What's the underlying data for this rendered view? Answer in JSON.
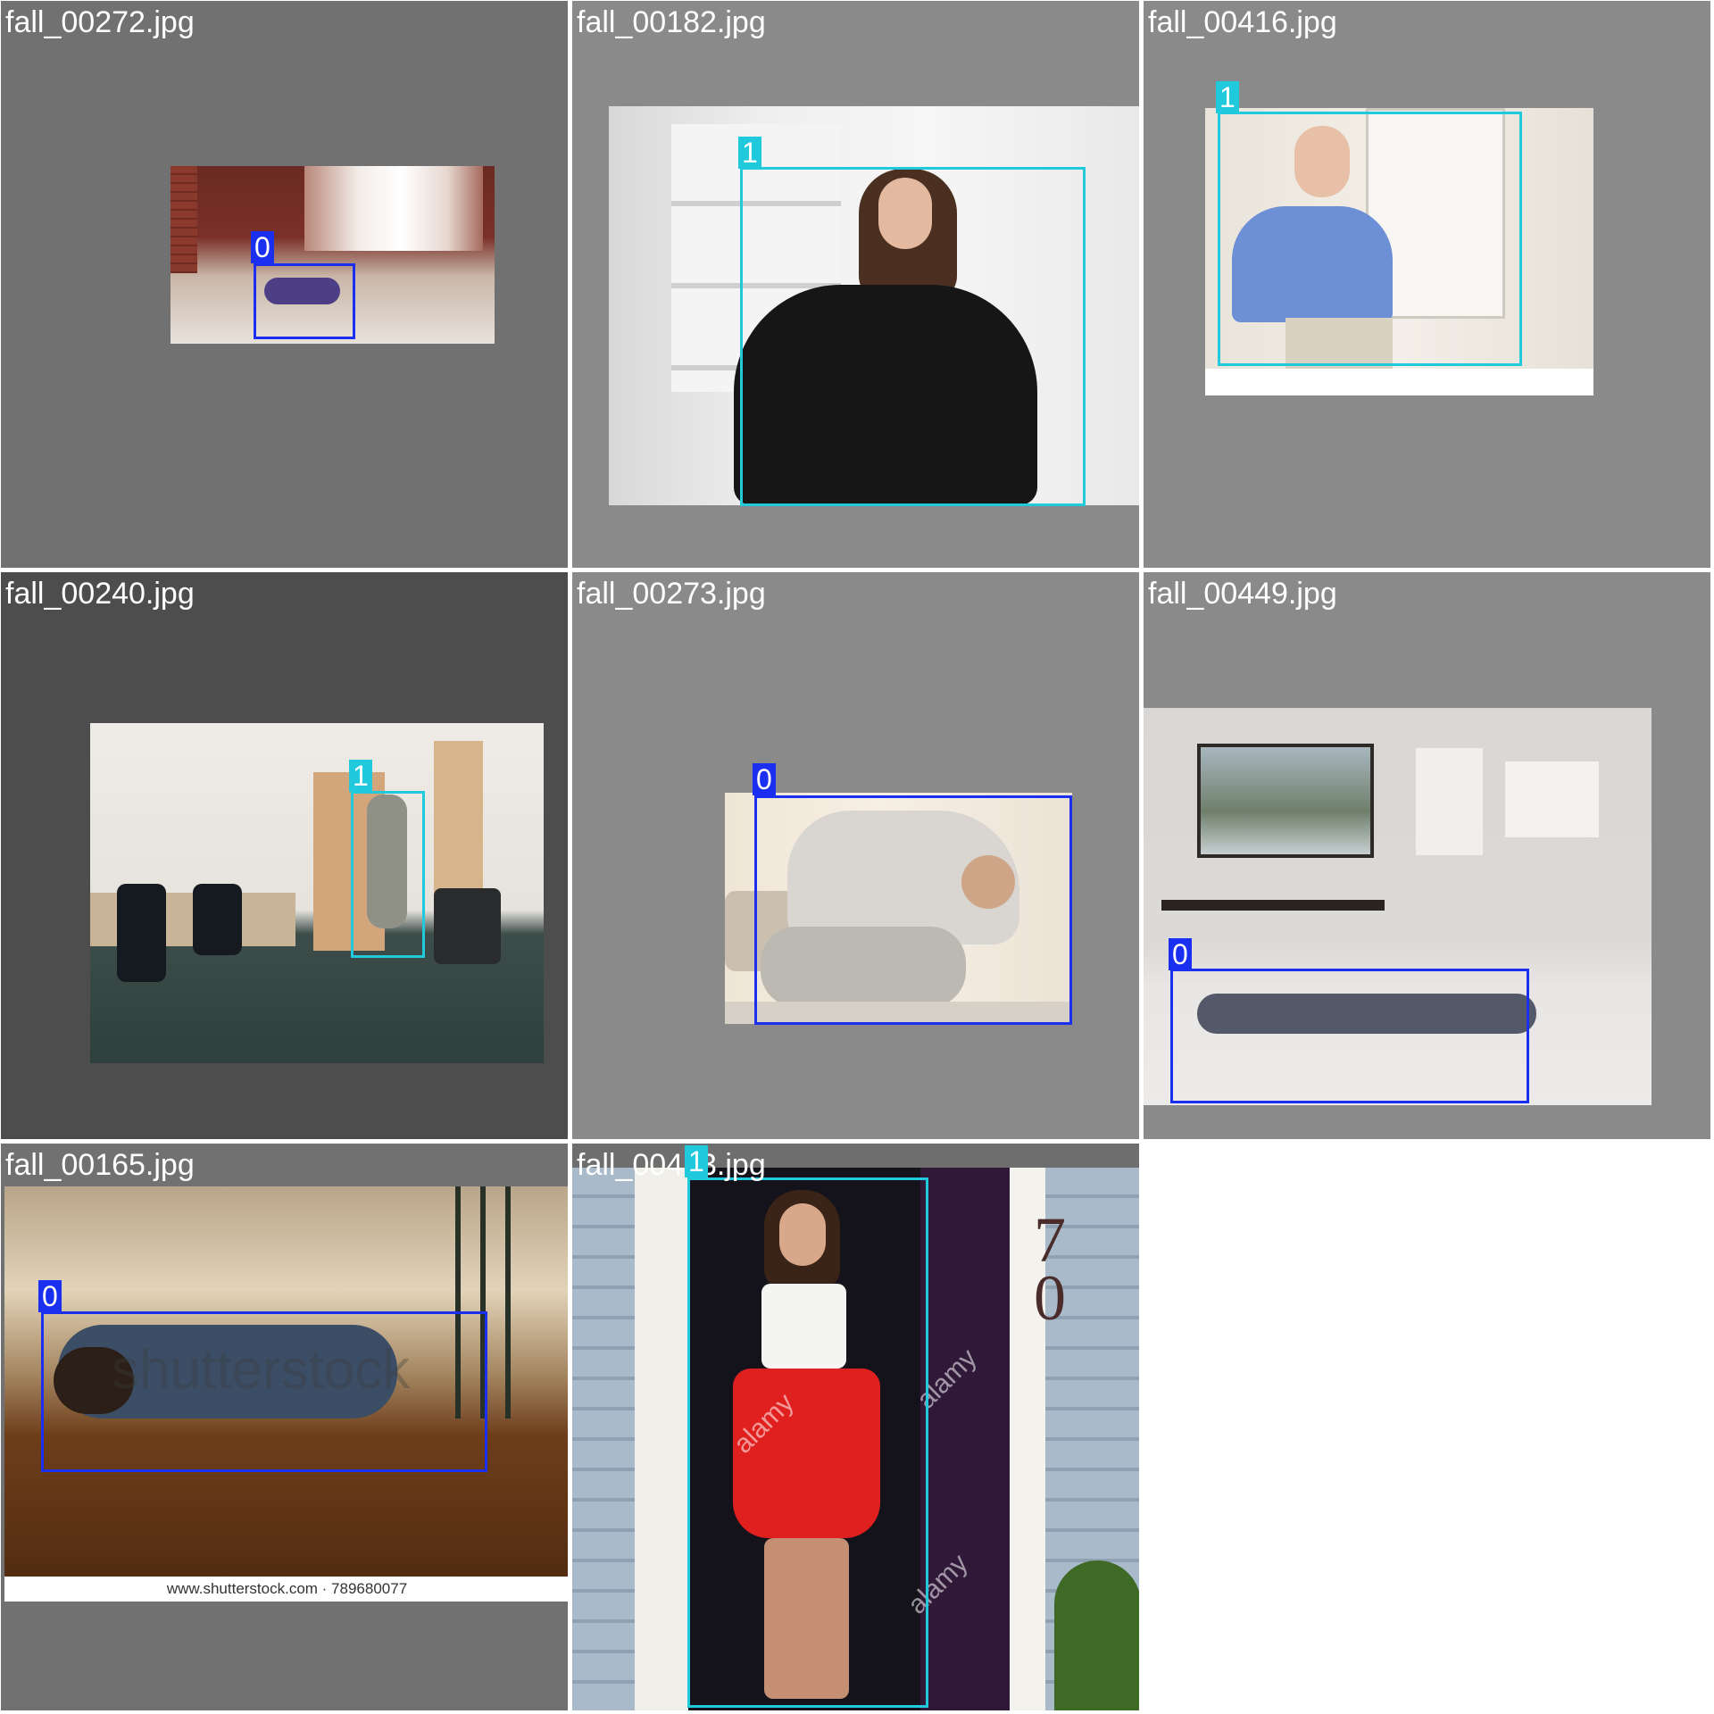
{
  "mosaic": {
    "background": "#ffffff",
    "colors": {
      "class_0": "#1a2ff0",
      "class_1": "#21c9dc"
    },
    "cells": [
      {
        "filename": "fall_00272.jpg",
        "labels": [
          "0"
        ]
      },
      {
        "filename": "fall_00182.jpg",
        "labels": [
          "1"
        ]
      },
      {
        "filename": "fall_00416.jpg",
        "labels": [
          "1"
        ]
      },
      {
        "filename": "fall_00240.jpg",
        "labels": [
          "1"
        ]
      },
      {
        "filename": "fall_00273.jpg",
        "labels": [
          "0"
        ]
      },
      {
        "filename": "fall_00449.jpg",
        "labels": [
          "0"
        ]
      },
      {
        "filename": "fall_00165.jpg",
        "labels": [
          "0"
        ],
        "watermark": "shutterstock",
        "caption": "www.shutterstock.com · 789680077"
      },
      {
        "filename": "fall_00413.jpg",
        "labels": [
          "1"
        ],
        "watermark": "alamy",
        "house_number": [
          "7",
          "0"
        ]
      }
    ]
  }
}
